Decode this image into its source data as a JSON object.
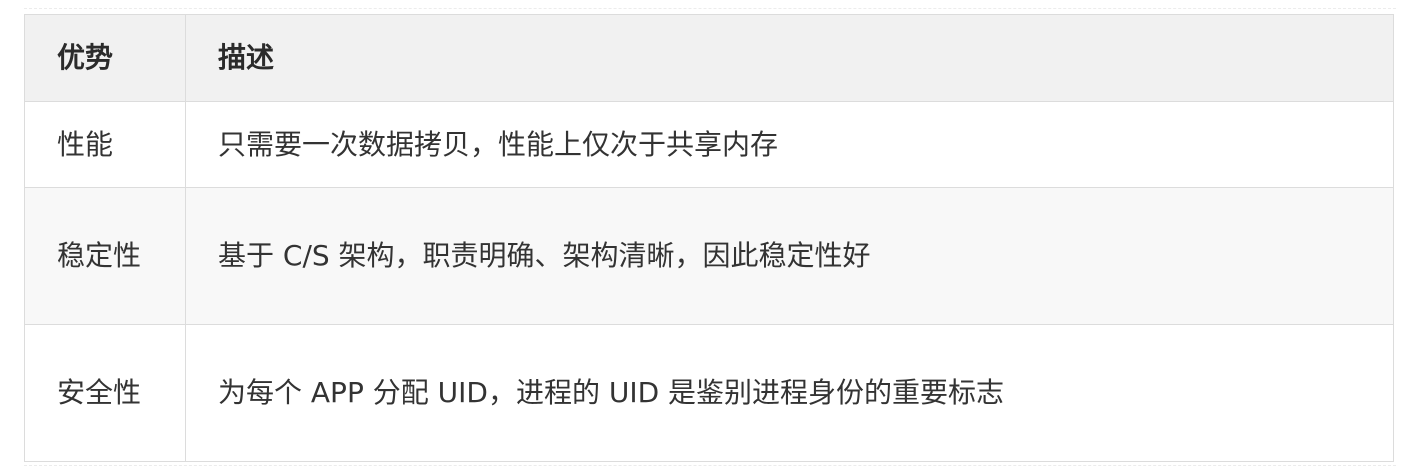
{
  "table": {
    "headers": [
      "优势",
      "描述"
    ],
    "rows": [
      {
        "advantage": "性能",
        "description": "只需要一次数据拷贝，性能上仅次于共享内存"
      },
      {
        "advantage": "稳定性",
        "description": "基于 C/S 架构，职责明确、架构清晰，因此稳定性好"
      },
      {
        "advantage": "安全性",
        "description": "为每个 APP 分配 UID，进程的 UID 是鉴别进程身份的重要标志"
      }
    ]
  }
}
